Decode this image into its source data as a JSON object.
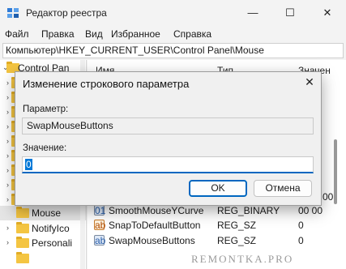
{
  "window": {
    "title": "Редактор реестра",
    "minimize_glyph": "—",
    "maximize_glyph": "☐",
    "close_glyph": "✕"
  },
  "menu": [
    "Файл",
    "Правка",
    "Вид",
    "Избранное",
    "Справка"
  ],
  "address_bar": "Компьютер\\HKEY_CURRENT_USER\\Control Panel\\Mouse",
  "tree": {
    "items": [
      {
        "label": "Control Pan",
        "expanded": true
      },
      {
        "label": "",
        "expanded": false
      },
      {
        "label": "",
        "expanded": false
      },
      {
        "label": "",
        "expanded": false
      },
      {
        "label": "",
        "expanded": false
      },
      {
        "label": "",
        "expanded": false
      },
      {
        "label": "",
        "expanded": false
      },
      {
        "label": "",
        "expanded": false
      },
      {
        "label": "",
        "expanded": false
      },
      {
        "label": "",
        "expanded": false
      },
      {
        "label": "Mouse",
        "selected": true
      },
      {
        "label": "NotifyIco"
      },
      {
        "label": "Personali"
      }
    ]
  },
  "list": {
    "columns": [
      "Имя",
      "Тип",
      "Значен"
    ],
    "rows": [
      {
        "name": "SmoothMouseYCurve",
        "type": "REG_BINARY",
        "value": "00 00",
        "icon": "binary-value-icon"
      },
      {
        "name": "SnapToDefaultButton",
        "type": "REG_SZ",
        "value": "0",
        "icon": "string-value-icon"
      },
      {
        "name": "SwapMouseButtons",
        "type": "REG_SZ",
        "value": "0",
        "icon": "string-value-icon"
      }
    ],
    "partial_value_above": "00"
  },
  "dialog": {
    "title": "Изменение строкового параметра",
    "param_label": "Параметр:",
    "param_value": "SwapMouseButtons",
    "value_label": "Значение:",
    "value": "0",
    "ok_label": "OK",
    "cancel_label": "Отмена"
  },
  "watermark": "REMONTKA.PRO"
}
